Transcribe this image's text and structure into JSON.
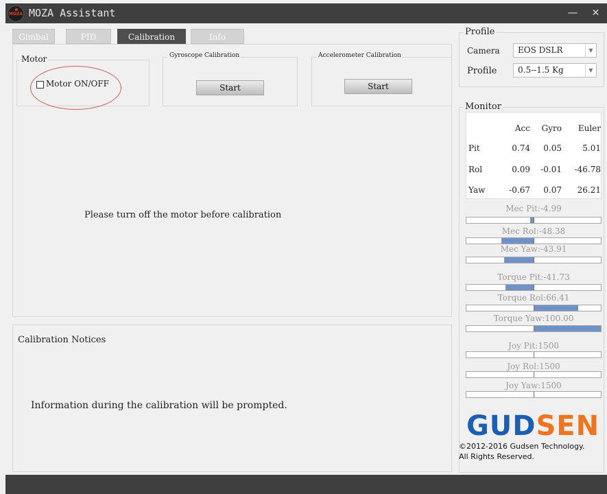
{
  "window": {
    "title": "MOZA Assistant",
    "logo_text": "MOZA",
    "minimize_glyph": "—",
    "close_glyph": "✕"
  },
  "tabs": [
    {
      "label": "Gimbal",
      "active": false
    },
    {
      "label": "PID",
      "active": false
    },
    {
      "label": "Calibration",
      "active": true
    },
    {
      "label": "Info",
      "active": false
    }
  ],
  "calibration": {
    "motor_group": "Motor",
    "motor_checkbox_label": "Motor ON/OFF",
    "motor_checked": false,
    "gyro_group": "Gyroscope Calibration",
    "gyro_button": "Start",
    "accel_group": "Accelerometer Calibration",
    "accel_button": "Start",
    "message": "Please turn off the motor before calibration"
  },
  "notices": {
    "title": "Calibration Notices",
    "text": "Information during the calibration will be prompted."
  },
  "profile": {
    "group": "Profile",
    "camera_label": "Camera",
    "camera_value": "EOS DSLR",
    "profile_label": "Profile",
    "profile_value": "0.5--1.5 Kg"
  },
  "monitor": {
    "group": "Monitor",
    "columns": [
      "Acc",
      "Gyro",
      "Euler"
    ],
    "rows": [
      {
        "label": "Pit",
        "values": [
          "0.74",
          "0.05",
          "5.01"
        ]
      },
      {
        "label": "Rol",
        "values": [
          "0.09",
          "-0.01",
          "-46.78"
        ]
      },
      {
        "label": "Yaw",
        "values": [
          "-0.67",
          "0.07",
          "26.21"
        ]
      }
    ],
    "bars": [
      {
        "label": "Mec Pit:-4.99",
        "value": -4.99
      },
      {
        "label": "Mec Rol:-48.38",
        "value": -48.38
      },
      {
        "label": "Mec Yaw:-43.91",
        "value": -43.91
      },
      {
        "label": "Torque Pit:-41.73",
        "value": -41.73
      },
      {
        "label": "Torque Rol:66.41",
        "value": 66.41
      },
      {
        "label": "Torque Yaw:100.00",
        "value": 100.0
      },
      {
        "label": "Joy Pit:1500",
        "value": 0
      },
      {
        "label": "Joy Rol:1500",
        "value": 0
      },
      {
        "label": "Joy Yaw:1500",
        "value": 0
      }
    ],
    "bar_range": [
      -100,
      100
    ]
  },
  "brand": {
    "logo_text": "GUDSEN",
    "copyright_line1": "©2012-2016 Gudsen Technology.",
    "copyright_line2": "All Rights Reserved."
  },
  "colors": {
    "accent": "#1a5fb4",
    "brand_orange": "#f0741e",
    "bar_fill": "#6f92c9",
    "highlight_circle": "#d45b5b"
  }
}
